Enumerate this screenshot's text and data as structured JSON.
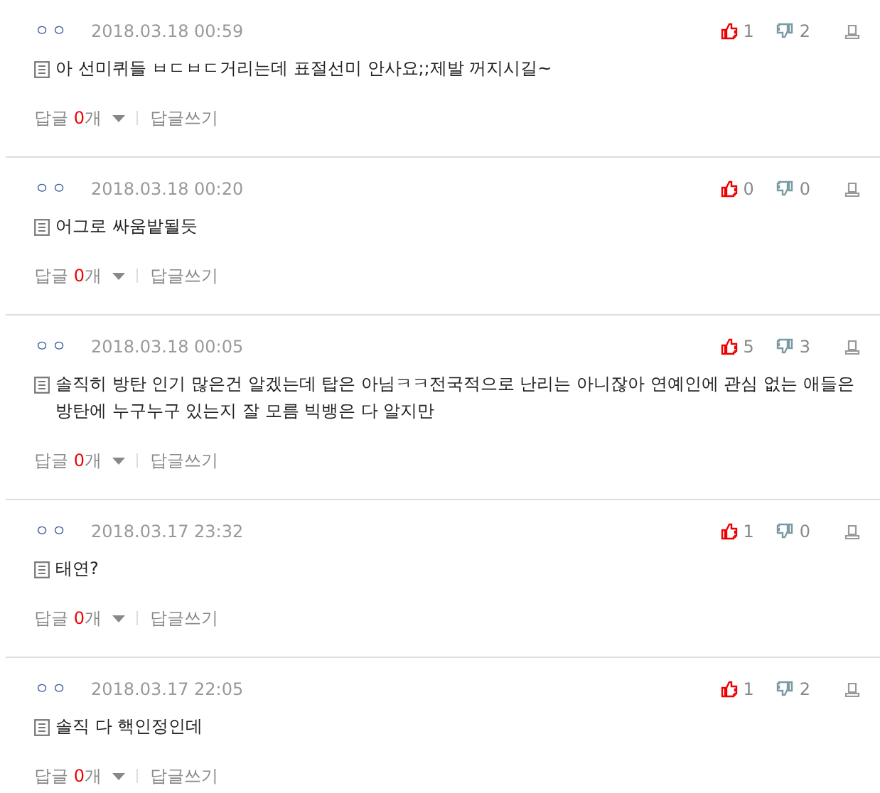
{
  "comments": [
    {
      "author": "ㅇㅇ",
      "date": "2018.03.18 00:59",
      "likes": "1",
      "dislikes": "2",
      "text": "아 선미퀴들 ㅂㄷㅂㄷ거리는데 표절선미 안사요;;제발 꺼지시길~",
      "reply_label": "답글",
      "reply_count": "0",
      "reply_unit": "개",
      "write_reply": "답글쓰기"
    },
    {
      "author": "ㅇㅇ",
      "date": "2018.03.18 00:20",
      "likes": "0",
      "dislikes": "0",
      "text": "어그로 싸움밭될듯",
      "reply_label": "답글",
      "reply_count": "0",
      "reply_unit": "개",
      "write_reply": "답글쓰기"
    },
    {
      "author": "ㅇㅇ",
      "date": "2018.03.18 00:05",
      "likes": "5",
      "dislikes": "3",
      "text": "솔직히 방탄 인기 많은건 알겠는데 탑은 아님ㅋㅋ전국적으로 난리는 아니잖아 연예인에 관심 없는 애들은 방탄에 누구누구 있는지 잘 모름 빅뱅은 다 알지만",
      "reply_label": "답글",
      "reply_count": "0",
      "reply_unit": "개",
      "write_reply": "답글쓰기"
    },
    {
      "author": "ㅇㅇ",
      "date": "2018.03.17 23:32",
      "likes": "1",
      "dislikes": "0",
      "text": "태연?",
      "reply_label": "답글",
      "reply_count": "0",
      "reply_unit": "개",
      "write_reply": "답글쓰기"
    },
    {
      "author": "ㅇㅇ",
      "date": "2018.03.17 22:05",
      "likes": "1",
      "dislikes": "2",
      "text": "솔직 다 핵인정인데",
      "reply_label": "답글",
      "reply_count": "0",
      "reply_unit": "개",
      "write_reply": "답글쓰기"
    }
  ]
}
